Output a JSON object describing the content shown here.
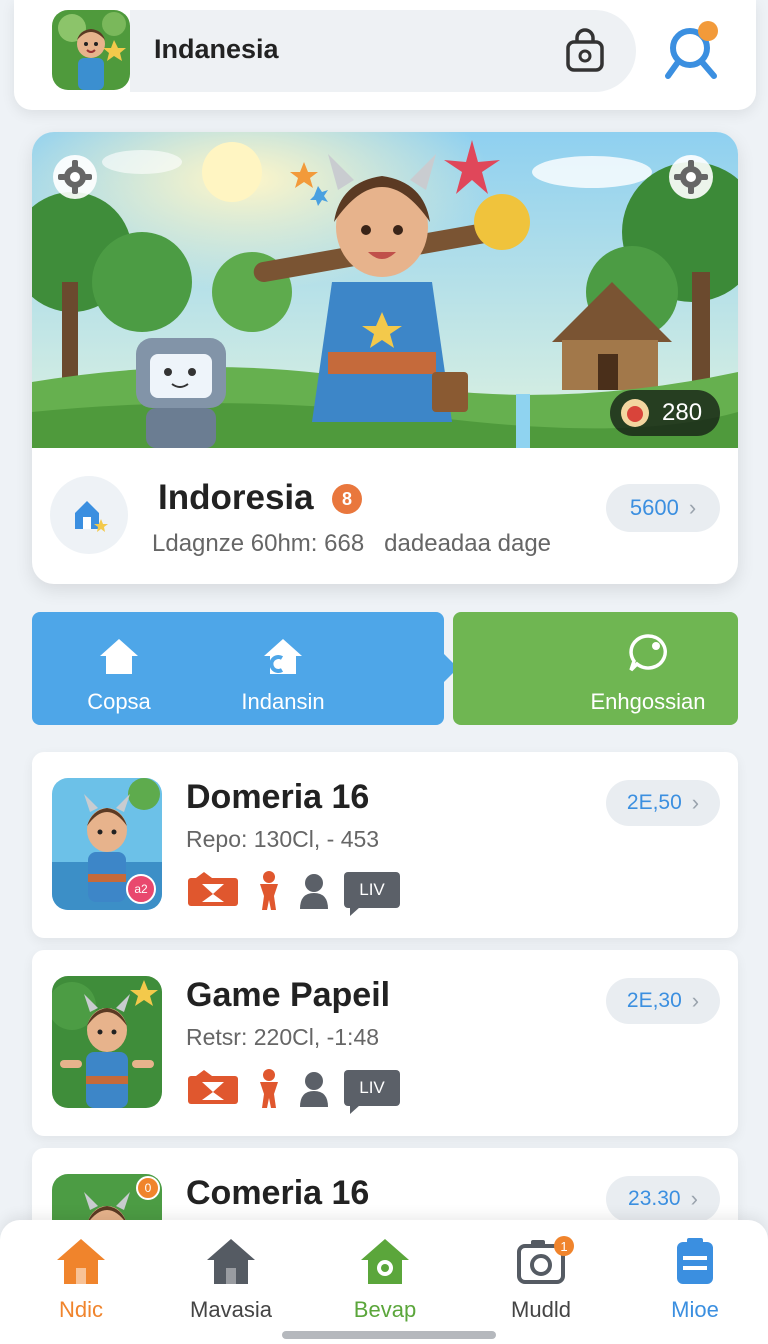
{
  "header": {
    "app_name": "Indanesia",
    "bag_icon": "shopping-bag-icon",
    "search_icon": "search-icon"
  },
  "hero": {
    "coin_count": "280",
    "title": "Indoresia",
    "badge": "8",
    "subtitle": "Ldagnze 60hm: 668   dadeadaa dage",
    "price": "5600"
  },
  "tabs": [
    {
      "label": "Copsa",
      "icon": "home-icon"
    },
    {
      "label": "Indansin",
      "icon": "house-signal-icon"
    },
    {
      "label": "Enhgossian",
      "icon": "chat-bubble-icon"
    }
  ],
  "list": [
    {
      "title": "Domeria 16",
      "meta": "Repo: 130Cl, - 453",
      "price": "2E,50",
      "thumb_badge": "a2",
      "live_label": "LIV"
    },
    {
      "title": "Game Papeil",
      "meta": "Retsr: 220Cl, -1:48",
      "price": "2E,30",
      "live_label": "LIV"
    },
    {
      "title": "Comeria 16",
      "meta": "",
      "price": "23.30",
      "thumb_badge": "0"
    }
  ],
  "bottom_nav": [
    {
      "label": "Ndic",
      "icon": "home-icon",
      "color": "#f0842c"
    },
    {
      "label": "Mavasia",
      "icon": "home-icon",
      "color": "#555b63"
    },
    {
      "label": "Bevap",
      "icon": "home-camera-icon",
      "color": "#5ba63b"
    },
    {
      "label": "Mudld",
      "icon": "camera-icon",
      "color": "#555b63",
      "badge": "1"
    },
    {
      "label": "Mioe",
      "icon": "clipboard-icon",
      "color": "#3b8fe0"
    }
  ],
  "colors": {
    "accent_blue": "#4ea6e8",
    "accent_green": "#6fb652",
    "accent_orange": "#f0842c"
  }
}
